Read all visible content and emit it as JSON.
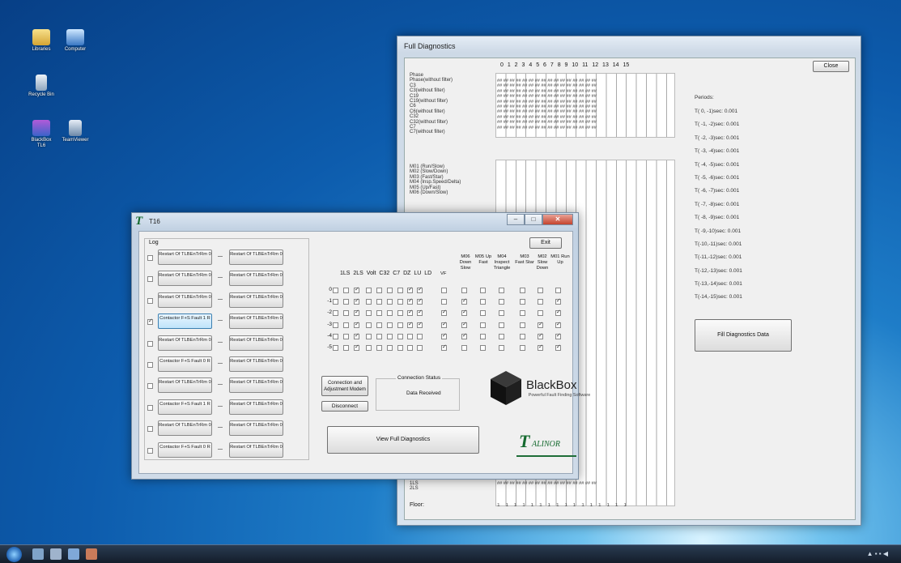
{
  "desktop": {
    "icons": [
      {
        "label": "Libraries"
      },
      {
        "label": "Computer"
      },
      {
        "label": "Recycle Bin"
      },
      {
        "label": "BlackBox TL6"
      },
      {
        "label": "TeamViewer"
      }
    ]
  },
  "full_diagnostics": {
    "title": "Full Diagnostics",
    "close_label": "Close",
    "column_numbers": "0 1 2 3 4 5 6 7 8 9 10 11 12 13 14 15",
    "group1_labels": [
      "Phase",
      "Phase(without filter)",
      "C3",
      "C3(without filter)",
      "C19",
      "C19(without filter)",
      "C6",
      "C6(without filter)",
      "C32",
      "C32(without filter)",
      "C7",
      "C7(without filter)"
    ],
    "group2_labels": [
      "M01 (Run/Slow)",
      "M02 (Slow/Down)",
      "M03 (Fast/Star)",
      "M04 (Insp.Speed/Delta)",
      "M05 (Up/Fast)",
      "M06 (Down/Slow)"
    ],
    "bottom_labels": [
      "1LS",
      "2LS"
    ],
    "floor_label": "Floor:",
    "floor_values": "1 1 1 1 1 1 1 1 1 1 1 1 1 1 1 1",
    "periods_title": "Periods:",
    "periods": [
      "T( 0, -1)sec: 0.001",
      "T( -1, -2)sec: 0.001",
      "T( -2, -3)sec: 0.001",
      "T( -3, -4)sec: 0.001",
      "T( -4, -5)sec: 0.001",
      "T( -5, -6)sec: 0.001",
      "T( -6, -7)sec: 0.001",
      "T( -7, -8)sec: 0.001",
      "T( -8, -9)sec: 0.001",
      "T( -9,-10)sec: 0.001",
      "T(-10,-11)sec: 0.001",
      "T(-11,-12)sec: 0.001",
      "T(-12,-13)sec: 0.001",
      "T(-13,-14)sec: 0.001",
      "T(-14,-15)sec: 0.001"
    ],
    "fill_button_label": "Fill Diagnostics Data"
  },
  "t16": {
    "title": "T16",
    "log_title": "Log",
    "log_rows": [
      {
        "left": "Restart Of TLBEnTrRm 0",
        "right": "Restart Of TLBEnTrRm 0",
        "checked": false
      },
      {
        "left": "Restart Of TLBEnTrRm 0",
        "right": "Restart Of TLBEnTrRm 0",
        "checked": false
      },
      {
        "left": "Restart Of TLBEnTrRm 0",
        "right": "Restart Of TLBEnTrRm 0",
        "checked": false
      },
      {
        "left": "Contactor F+S Fault 1 R",
        "right": "Restart Of TLBEnTrRm 0",
        "checked": true
      },
      {
        "left": "Restart Of TLBEnTrRm 0",
        "right": "Restart Of TLBEnTrRm 0",
        "checked": false
      },
      {
        "left": "Contactor F+S Fault 0 R",
        "right": "Restart Of TLBEnTrRm 0",
        "checked": false
      },
      {
        "left": "Restart Of TLBEnTrRm 0",
        "right": "Restart Of TLBEnTrRm 0",
        "checked": false
      },
      {
        "left": "Contactor F+S Fault 1 R",
        "right": "Restart Of TLBEnTrRm 0",
        "checked": false
      },
      {
        "left": "Restart Of TLBEnTrRm 0",
        "right": "Restart Of TLBEnTrRm 0",
        "checked": false
      },
      {
        "left": "Contactor F+S Fault 0 R",
        "right": "Restart Of TLBEnTrRm 0",
        "checked": false
      }
    ],
    "exit_label": "Exit",
    "table_header": "1LS 2LS Volt C32 C7 DZ LU LD",
    "vf_header": "VF",
    "m_headers": [
      "M06 Down Slow",
      "M05 Up Fast",
      "M04 Inspect Triangle",
      "M03 Fast Star",
      "M02 Slow Down",
      "M01 Run Up"
    ],
    "row_labels": [
      "0",
      "-1",
      "-2",
      "-3",
      "-4",
      "-5"
    ],
    "left_checks": [
      [
        0,
        1,
        0,
        0,
        0,
        0,
        1,
        1
      ],
      [
        0,
        1,
        0,
        0,
        0,
        0,
        1,
        1
      ],
      [
        0,
        1,
        0,
        0,
        0,
        0,
        1,
        1
      ],
      [
        0,
        1,
        0,
        0,
        0,
        0,
        1,
        1
      ],
      [
        0,
        1,
        0,
        0,
        0,
        0,
        0,
        0
      ],
      [
        0,
        1,
        0,
        0,
        0,
        0,
        0,
        0
      ]
    ],
    "right_checks": [
      [
        0,
        0,
        0,
        0,
        0,
        0,
        0
      ],
      [
        0,
        1,
        0,
        0,
        0,
        0,
        1
      ],
      [
        1,
        1,
        0,
        0,
        0,
        0,
        1
      ],
      [
        1,
        1,
        0,
        0,
        0,
        1,
        1
      ],
      [
        1,
        1,
        0,
        0,
        0,
        1,
        1
      ],
      [
        1,
        0,
        0,
        0,
        0,
        1,
        1
      ]
    ],
    "connection_button_label": "Connection and Adjustment Modem",
    "disconnect_label": "Disconnect",
    "status_caption": "Connection Status",
    "status_value": "Data Received",
    "brand_title": "BlackBox",
    "brand_subtitle": "Powerful Fault Finding Software",
    "view_button_label": "View Full Diagnostics",
    "talinor_t": "T",
    "talinor_rest": "ALINOR"
  }
}
